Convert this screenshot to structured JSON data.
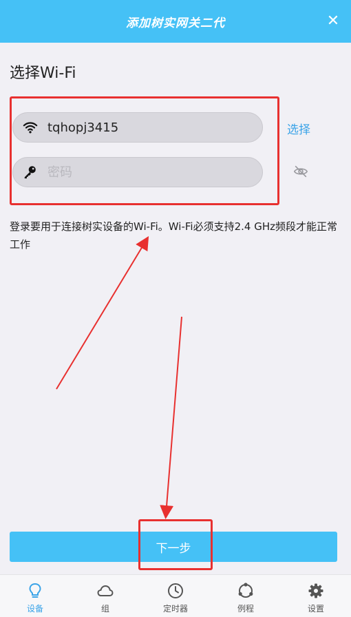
{
  "header": {
    "title": "添加树实网关二代",
    "close_icon": "close-icon"
  },
  "section_title": "选择Wi-Fi",
  "wifi": {
    "ssid_value": "tqhopj3415",
    "password_placeholder": "密码",
    "select_label": "选择",
    "wifi_icon": "wifi-icon",
    "key_icon": "key-icon",
    "eye_icon": "eye-off-icon"
  },
  "description": "登录要用于连接树实设备的Wi-Fi。Wi-Fi必须支持2.4 GHz频段才能正常工作",
  "next_button": "下一步",
  "tabs": [
    {
      "label": "设备",
      "icon": "bulb-icon",
      "active": true
    },
    {
      "label": "组",
      "icon": "cloud-icon",
      "active": false
    },
    {
      "label": "定时器",
      "icon": "clock-icon",
      "active": false
    },
    {
      "label": "例程",
      "icon": "routine-icon",
      "active": false
    },
    {
      "label": "设置",
      "icon": "gear-icon",
      "active": false
    }
  ],
  "colors": {
    "primary": "#45c1f6",
    "link": "#3aa3e8",
    "annotation": "#e8302f",
    "background": "#f1f0f5"
  }
}
